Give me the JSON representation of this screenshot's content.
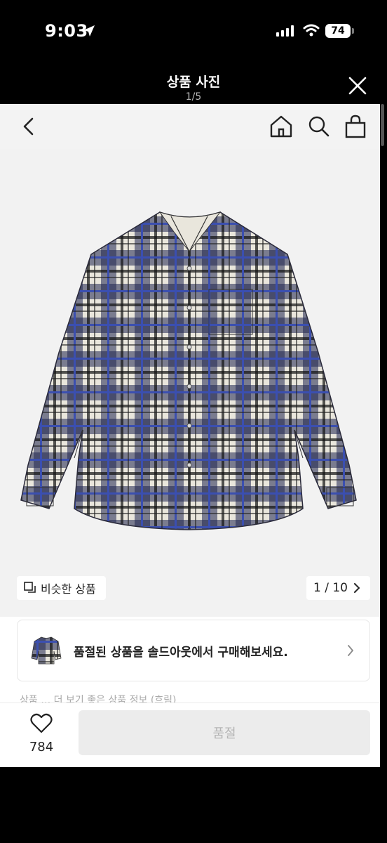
{
  "status_bar": {
    "time": "9:03",
    "battery": "74"
  },
  "viewer": {
    "title": "상품 사진",
    "counter": "1/5"
  },
  "image_nav": {
    "similar_label": "비슷한 상품",
    "counter": "1 / 10"
  },
  "soldout_banner": {
    "text": "품절된 상품을 솔드아웃에서 구매해보세요."
  },
  "faded_text": "상품 … 더 보기 좋은 상품 정보 (흐림)",
  "bottom_bar": {
    "like_count": "784",
    "buy_label": "품절"
  },
  "colors": {
    "plaid_navy": "#1f2550",
    "plaid_cream": "#e9e6dc",
    "plaid_blue": "#3b4fb0"
  }
}
